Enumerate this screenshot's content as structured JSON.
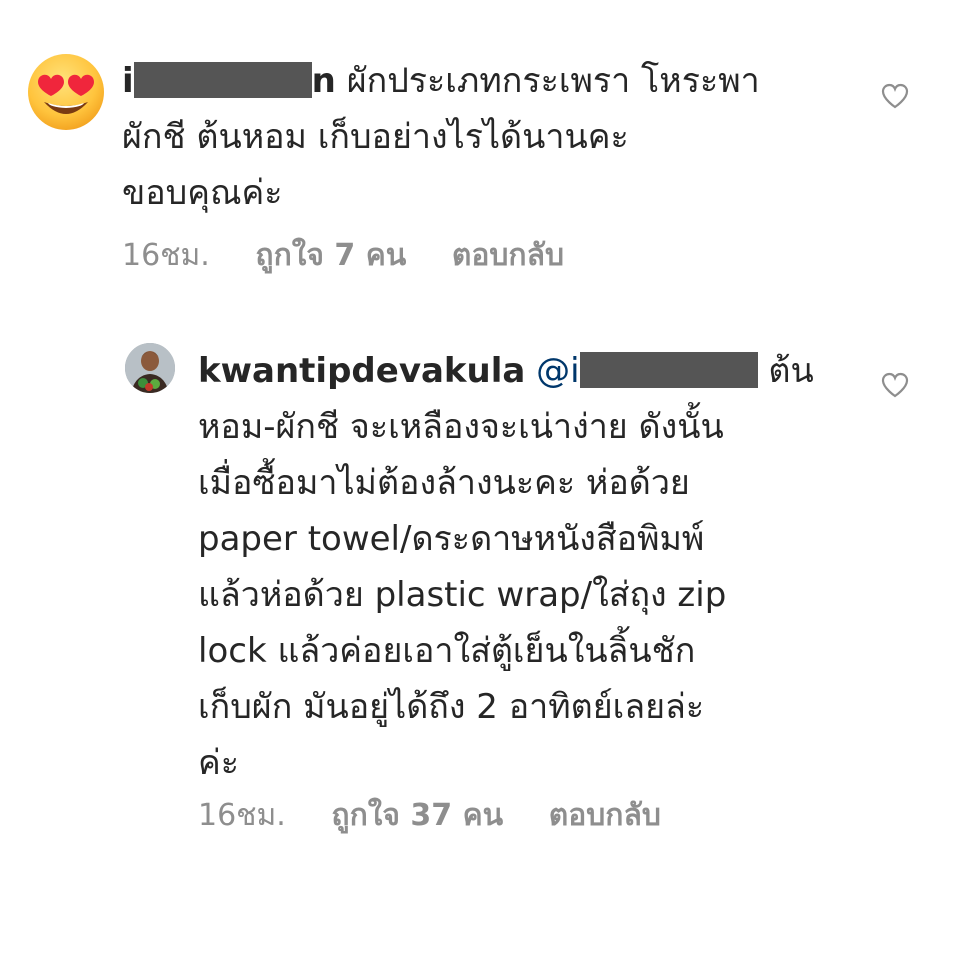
{
  "comments": [
    {
      "username_visible_start": "i",
      "username_visible_end": "n",
      "text_line1": "ผักประเภทกระเพรา โหระพา",
      "text_line2": "ผักชี ต้นหอม เก็บอย่างไรได้นานคะ",
      "text_line3": "ขอบคุณค่ะ",
      "time": "16ชม.",
      "likes": "ถูกใจ 7 คน",
      "reply": "ตอบกลับ",
      "avatar_icon": "heart-eyes-emoji"
    },
    {
      "username": "kwantipdevakula",
      "mention_prefix": "@i",
      "line1_tail": "ต้น",
      "line2": "หอม-ผักชี จะเหลืองจะเน่าง่าย ดังนั้น",
      "line3": "เมื่อซื้อมาไม่ต้องล้างนะคะ ห่อด้วย",
      "line4": "paper towel/ดระดาษหนังสือพิมพ์",
      "line5": "แล้วห่อด้วย plastic wrap/ใส่ถุง zip",
      "line6": "lock แล้วค่อยเอาใส่ตู้เย็นในลิ้นชัก",
      "line7": "เก็บผัก มันอยู่ได้ถึง 2 อาทิตย์เลยล่ะ",
      "line8": "ค่ะ",
      "time": "16ชม.",
      "likes": "ถูกใจ 37 คน",
      "reply": "ตอบกลับ",
      "avatar_icon": "profile-photo"
    }
  ],
  "colors": {
    "text": "#262626",
    "meta": "#8e8e8e",
    "mention": "#00376b"
  }
}
